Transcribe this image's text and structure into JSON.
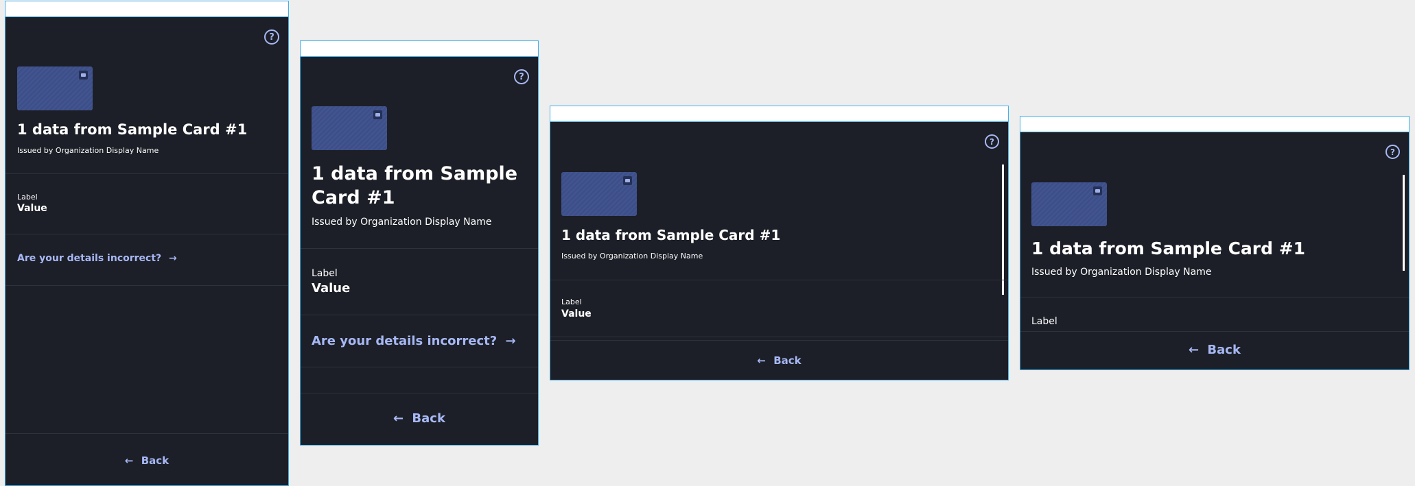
{
  "frames": [
    {
      "name": "pixel2_portrait",
      "help_icon": "help-circle-icon",
      "card_logo_icon": "card-issuer-logo-icon",
      "title": "1 data from Sample Card #1",
      "issuer": "Issued by Organization Display Name",
      "field": {
        "label": "Label",
        "value": "Value"
      },
      "link": "Are your details incorrect?",
      "link_icon": "arrow-right-icon",
      "back": "Back",
      "back_icon": "arrow-left-icon"
    },
    {
      "name": "pixel2_portrait_large",
      "help_icon": "help-circle-icon",
      "card_logo_icon": "card-issuer-logo-icon",
      "title_line1": "1 data from Sample",
      "title_line2": "Card #1",
      "issuer": "Issued by Organization Display Name",
      "field": {
        "label": "Label",
        "value": "Value"
      },
      "link": "Are your details incorrect?",
      "link_icon": "arrow-right-icon",
      "back": "Back",
      "back_icon": "arrow-left-icon"
    },
    {
      "name": "pixel2_landscape",
      "help_icon": "help-circle-icon",
      "card_logo_icon": "card-issuer-logo-icon",
      "title": "1 data from Sample Card #1",
      "issuer": "Issued by Organization Display Name",
      "field": {
        "label": "Label",
        "value": "Value"
      },
      "back": "Back",
      "back_icon": "arrow-left-icon"
    },
    {
      "name": "pixel2_landscape_large",
      "help_icon": "help-circle-icon",
      "card_logo_icon": "card-issuer-logo-icon",
      "title": "1 data from Sample Card #1",
      "issuer": "Issued by Organization Display Name",
      "field": {
        "label": "Label"
      },
      "back": "Back",
      "back_icon": "arrow-left-icon"
    }
  ],
  "colors": {
    "background": "#1c1f27",
    "accent": "#a7b8f5",
    "card": "#3d4f8a",
    "frame_border": "#3fb0ea",
    "canvas": "#eeeeee"
  }
}
